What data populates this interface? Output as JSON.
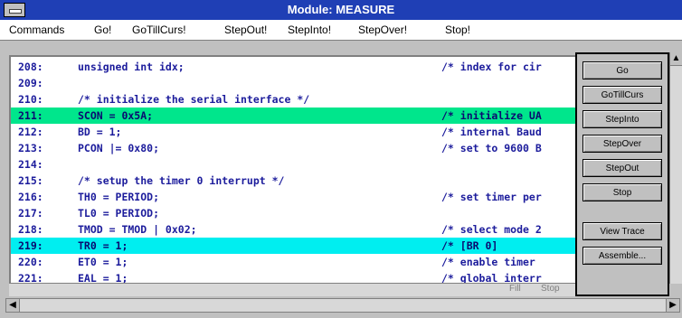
{
  "window": {
    "title": "Module: MEASURE"
  },
  "menu": [
    "Commands",
    "Go!",
    "GoTillCurs!",
    "StepOut!",
    "StepInto!",
    "StepOver!",
    "Stop!"
  ],
  "code_lines": [
    {
      "ln": "208:",
      "src": "unsigned int idx;",
      "cm": "/* index for cir"
    },
    {
      "ln": "209:",
      "src": "",
      "cm": ""
    },
    {
      "ln": "210:",
      "src": "/* initialize the serial interface */",
      "cm": ""
    },
    {
      "ln": "211:",
      "src": "SCON = 0x5A;",
      "cm": "/* initialize UA"
    },
    {
      "ln": "212:",
      "src": "BD = 1;",
      "cm": "/* internal Baud"
    },
    {
      "ln": "213:",
      "src": "PCON |= 0x80;",
      "cm": "/* set to 9600 B"
    },
    {
      "ln": "214:",
      "src": "",
      "cm": ""
    },
    {
      "ln": "215:",
      "src": "/* setup the timer 0 interrupt */",
      "cm": ""
    },
    {
      "ln": "216:",
      "src": "TH0 = PERIOD;",
      "cm": "/* set timer per"
    },
    {
      "ln": "217:",
      "src": "TL0 = PERIOD;",
      "cm": ""
    },
    {
      "ln": "218:",
      "src": "TMOD = TMOD | 0x02;",
      "cm": "/* select mode 2"
    },
    {
      "ln": "219:",
      "src": "TR0 = 1;",
      "cm": "/* [BR 0]"
    },
    {
      "ln": "220:",
      "src": "ET0 = 1;",
      "cm": "/* enable timer"
    },
    {
      "ln": "221:",
      "src": "EAL = 1;",
      "cm": "/* global interr"
    }
  ],
  "highlight": {
    "green_line": "211:",
    "cyan_line": "219:"
  },
  "buttons": [
    "Go",
    "GoTillCurs",
    "StepInto",
    "StepOver",
    "StepOut",
    "Stop",
    "View Trace",
    "Assemble..."
  ],
  "status": {
    "left": "Fill",
    "right": "Stop"
  },
  "colors": {
    "title_bar": "#1f3fb5",
    "green": "#00e68c",
    "cyan": "#00eef0",
    "code_text": "#1c1c9c"
  }
}
